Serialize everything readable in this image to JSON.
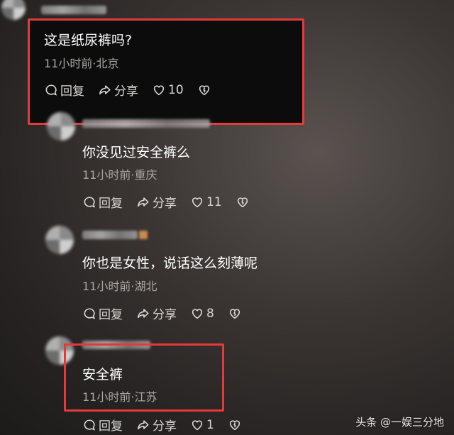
{
  "comments": [
    {
      "text": "这是纸尿裤吗?",
      "meta": "11小时前·北京",
      "reply_label": "回复",
      "share_label": "分享",
      "like_count": "10"
    },
    {
      "text": "你没见过安全裤么",
      "meta": "11小时前·重庆",
      "reply_label": "回复",
      "share_label": "分享",
      "like_count": "11"
    },
    {
      "text": "你也是女性，说话这么刻薄呢",
      "meta": "11小时前·湖北",
      "reply_label": "回复",
      "share_label": "分享",
      "like_count": "8"
    },
    {
      "text": "安全裤",
      "meta": "11小时前·江苏",
      "reply_label": "回复",
      "share_label": "分享",
      "like_count": "1"
    }
  ],
  "watermark": "头条 @一娱三分地",
  "colors": {
    "highlight_border": "#e53a3a",
    "meta_text": "#a8a6a4"
  }
}
